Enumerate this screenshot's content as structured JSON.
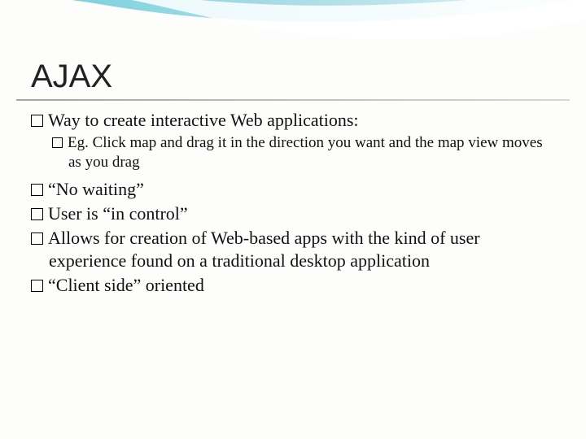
{
  "title": "AJAX",
  "bullets": {
    "b1": "Way to create interactive Web applications:",
    "b1a": "Eg. Click map and drag it in the direction you want and the map view moves as you drag",
    "b2": "“No waiting”",
    "b3": "User is “in control”",
    "b4": "Allows for creation of Web-based apps with the kind of user experience found on a traditional desktop application",
    "b5": "“Client side” oriented"
  }
}
